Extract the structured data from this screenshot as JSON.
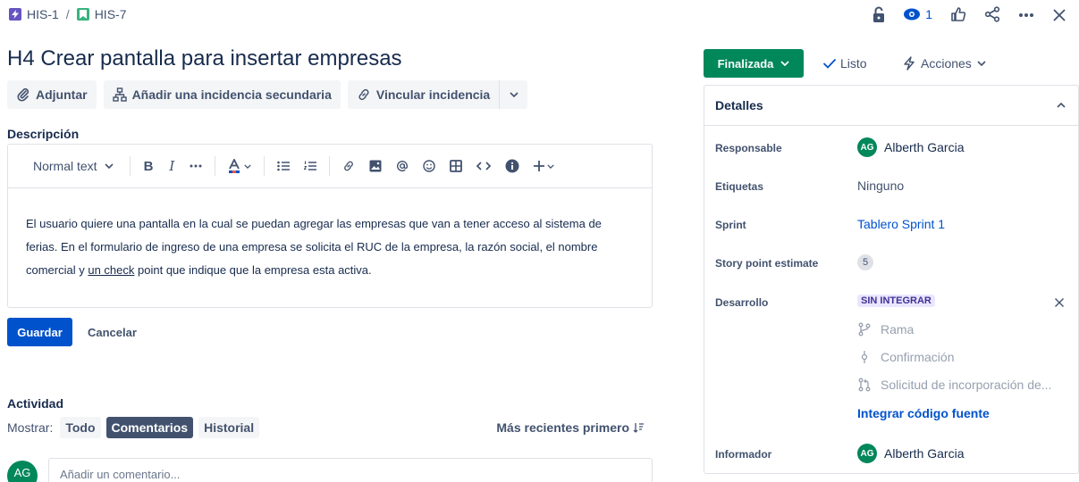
{
  "breadcrumb": {
    "parent": "HIS-1",
    "separator": "/",
    "current": "HIS-7",
    "parent_color": "#6554c0",
    "current_color": "#36b37e"
  },
  "top_actions": {
    "lock_icon": "lock-icon",
    "watch_count": "1",
    "like_icon": "thumbs-up-icon",
    "share_icon": "share-icon",
    "more_icon": "more-icon",
    "close_icon": "close-icon"
  },
  "issue": {
    "title": "H4 Crear pantalla para insertar empresas"
  },
  "toolbar": {
    "attach_label": "Adjuntar",
    "child_label": "Añadir una incidencia secundaria",
    "link_label": "Vincular incidencia"
  },
  "description": {
    "label": "Descripción",
    "format_label": "Normal text",
    "text_before": "El usuario quiere una pantalla en la cual se puedan agregar las empresas que van a tener acceso al sistema de ferias. En el formulario de ingreso de una empresa se solicita el RUC de la empresa, la razón social, el nombre comercial y ",
    "text_underlined": "un check",
    "text_after": " point que indique que la empresa esta activa.",
    "save_label": "Guardar",
    "cancel_label": "Cancelar"
  },
  "activity": {
    "title": "Actividad",
    "show_label": "Mostrar:",
    "filters": [
      "Todo",
      "Comentarios",
      "Historial"
    ],
    "active_filter": "Comentarios",
    "sort_label": "Más recientes primero",
    "avatar_initials": "AG",
    "comment_placeholder": "Añadir un comentario..."
  },
  "status": {
    "label": "Finalizada",
    "color": "#00875a",
    "resolution_label": "Listo",
    "actions_label": "Acciones"
  },
  "details": {
    "title": "Detalles",
    "assignee_label": "Responsable",
    "assignee_name": "Alberth Garcia",
    "assignee_initials": "AG",
    "labels_label": "Etiquetas",
    "labels_value": "Ninguno",
    "sprint_label": "Sprint",
    "sprint_value": "Tablero Sprint 1",
    "story_points_label": "Story point estimate",
    "story_points_value": "5",
    "development_label": "Desarrollo",
    "development_badge": "SIN INTEGRAR",
    "dev_branch": "Rama",
    "dev_commit": "Confirmación",
    "dev_pr": "Solicitud de incorporación de...",
    "dev_integrate": "Integrar código fuente",
    "reporter_label": "Informador",
    "reporter_name": "Alberth Garcia",
    "reporter_initials": "AG"
  }
}
